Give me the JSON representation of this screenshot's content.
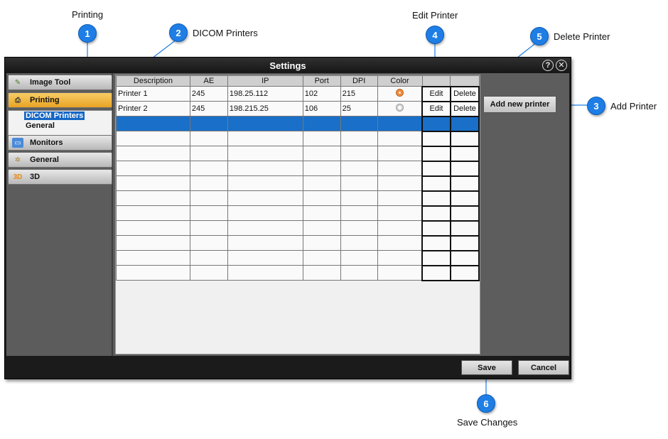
{
  "window": {
    "title": "Settings"
  },
  "sidebar": {
    "categories": [
      {
        "label": "Image Tool",
        "icon": "image-tool-icon"
      },
      {
        "label": "Printing",
        "icon": "printer-icon"
      },
      {
        "label": "Monitors",
        "icon": "monitor-icon"
      },
      {
        "label": "General",
        "icon": "general-icon"
      },
      {
        "label": "3D",
        "icon": "3d-icon",
        "icon_text": "3D"
      }
    ],
    "printing_sub_items": [
      "DICOM Printers",
      "General"
    ]
  },
  "printers_table": {
    "headers": [
      "Description",
      "AE",
      "IP",
      "Port",
      "DPI",
      "Color",
      "",
      ""
    ],
    "rows": [
      {
        "description": "Printer 1",
        "ae": "245",
        "ip": "198.25.112",
        "port": "102",
        "dpi": "215",
        "color": true,
        "edit": "Edit",
        "delete": "Delete"
      },
      {
        "description": "Printer 2",
        "ae": "245",
        "ip": "198.215.25",
        "port": "106",
        "dpi": "25",
        "color": false,
        "edit": "Edit",
        "delete": "Delete"
      }
    ],
    "empty_rows": 10
  },
  "buttons": {
    "add_new_printer": "Add new printer",
    "save": "Save",
    "cancel": "Cancel"
  },
  "callouts": [
    {
      "number": "1",
      "label": "Printing"
    },
    {
      "number": "2",
      "label": "DICOM Printers"
    },
    {
      "number": "3",
      "label": "Add Printer"
    },
    {
      "number": "4",
      "label": "Edit Printer"
    },
    {
      "number": "5",
      "label": "Delete Printer"
    },
    {
      "number": "6",
      "label": "Save Changes"
    }
  ],
  "colors": {
    "accent_blue": "#1e7ee6",
    "active_category": "#f0b440",
    "selection": "#1a6fc8",
    "radio_on": "#f07a22"
  }
}
